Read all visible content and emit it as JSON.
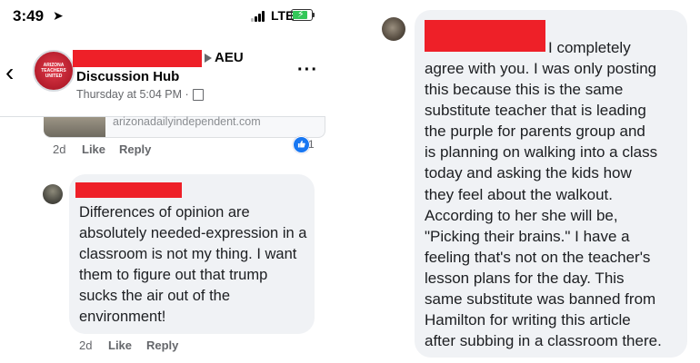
{
  "status_bar": {
    "time": "3:49",
    "location_arrow": "➤",
    "network": "LTE",
    "battery_level": 0.9,
    "icons": [
      "location-arrow-icon",
      "signal-bars-icon",
      "battery-charging-icon"
    ]
  },
  "header": {
    "back_glyph": "‹",
    "group_tag": "AEU",
    "group_name": "Discussion Hub",
    "post_time": "Thursday at 5:04 PM ·",
    "more_glyph": "···",
    "avatar_text": [
      "ARIZONA",
      "TEACHERS",
      "UNITED"
    ]
  },
  "link_preview": {
    "domain": "arizonadailyindependent.com"
  },
  "post_actions": {
    "age": "2d",
    "like": "Like",
    "reply": "Reply",
    "reaction_count": "1"
  },
  "comment_left": {
    "lines": [
      "Differences of opinion are",
      "absolutely needed-expression in a",
      "classroom is not my thing.  I want",
      "them to figure out that trump",
      "sucks the air out of the",
      "environment!"
    ],
    "age": "2d",
    "like": "Like",
    "reply": "Reply"
  },
  "comment_right": {
    "first_line": "I completely",
    "lines": [
      "agree with you. I was only posting",
      "this because this is the same",
      "substitute teacher that is leading",
      "the purple for parents group and",
      "is planning on walking into a class",
      "today and asking the kids how",
      "they feel about the walkout.",
      "According to her she will be,",
      "\"Picking their brains.\" I have a",
      "feeling that's not on the teacher's",
      "lesson plans for the day. This",
      "same substitute was banned from",
      "Hamilton for writing this article",
      "after subbing in a classroom there."
    ]
  },
  "colors": {
    "redaction": "#ee2028",
    "bubble": "#f0f2f5",
    "meta_text": "#65676b",
    "like_blue": "#1877f2"
  }
}
